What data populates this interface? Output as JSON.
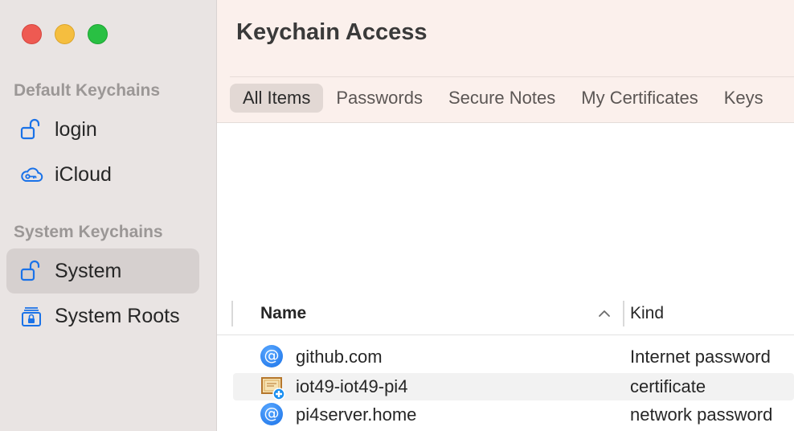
{
  "window": {
    "title": "Keychain Access"
  },
  "sidebar": {
    "default_section_label": "Default Keychains",
    "system_section_label": "System Keychains",
    "items": [
      {
        "label": "login",
        "icon": "unlock-icon"
      },
      {
        "label": "iCloud",
        "icon": "icloud-key-icon"
      },
      {
        "label": "System",
        "icon": "unlock-icon",
        "selected": true
      },
      {
        "label": "System Roots",
        "icon": "cabinet-lock-icon"
      }
    ]
  },
  "tabs": [
    "All Items",
    "Passwords",
    "Secure Notes",
    "My Certificates",
    "Keys"
  ],
  "active_tab": "All Items",
  "table": {
    "columns": {
      "name": "Name",
      "kind": "Kind"
    },
    "sort": "Name ascending",
    "rows": [
      {
        "name": "github.com",
        "kind": "Internet password",
        "icon": "at-sign-icon"
      },
      {
        "name": "iot49-iot49-pi4",
        "kind": "certificate",
        "icon": "certificate-icon"
      },
      {
        "name": "pi4server.home",
        "kind": "network password",
        "icon": "at-sign-icon"
      }
    ]
  },
  "colors": {
    "sidebar_bg": "#e9e4e3",
    "toolbar_bg": "#fbf0ec",
    "accent_blue": "#1a72e8",
    "close": "#ee5a52",
    "minimize": "#f5be3f",
    "zoom": "#29c043"
  }
}
